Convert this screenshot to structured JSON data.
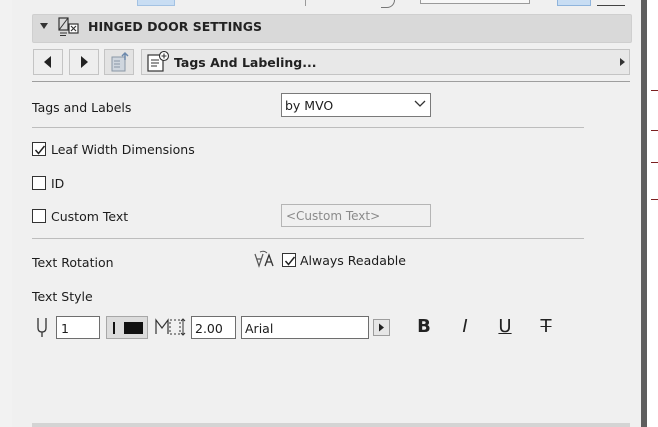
{
  "header": {
    "title": "HINGED DOOR SETTINGS",
    "collapse_icon": "triangle-down-icon",
    "section_icon": "door-settings-icon"
  },
  "page_nav": {
    "selected_page": "Tags And Labeling...",
    "prev_icon": "triangle-left-icon",
    "next_icon": "triangle-right-icon",
    "favorite_icon": "favorite-page-icon",
    "page_icon": "tags-labeling-icon",
    "expand_icon": "triangle-right-icon"
  },
  "tags_labels": {
    "label": "Tags and Labels",
    "value": "by MVO"
  },
  "checkboxes": {
    "leaf_width": {
      "label": "Leaf Width Dimensions",
      "checked": true
    },
    "id": {
      "label": "ID",
      "checked": false
    },
    "custom_text": {
      "label": "Custom Text",
      "checked": false
    }
  },
  "custom_text_field": {
    "placeholder": "<Custom Text>"
  },
  "text_rotation": {
    "label": "Text Rotation",
    "always_readable": {
      "label": "Always Readable",
      "checked": true
    }
  },
  "text_style": {
    "label": "Text Style",
    "pen_value": "1",
    "size_value": "2.00",
    "font_value": "Arial",
    "bold_glyph": "B",
    "italic_glyph": "I",
    "underline_glyph": "U",
    "strike_glyph": "T"
  },
  "colors": {
    "panel_bg": "#f0f0f0",
    "header_bg": "#d9d9d9",
    "accent": "#c8ddf3"
  }
}
